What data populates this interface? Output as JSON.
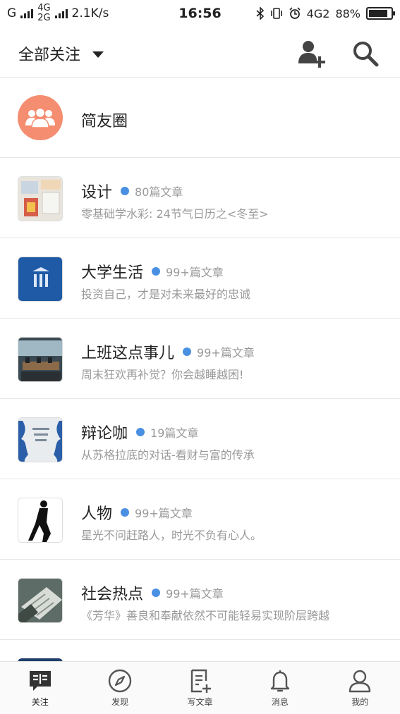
{
  "status_bar": {
    "sim1": "G",
    "net_top": "4G",
    "net_bottom": "2G",
    "speed": "2.1K/s",
    "time": "16:56",
    "net_right": "4G2",
    "battery": "88%",
    "battery_level": 0.88
  },
  "header": {
    "title": "全部关注"
  },
  "circle": {
    "label": "简友圈",
    "color": "#f58d70"
  },
  "feeds": [
    {
      "name": "设计",
      "count": "80篇文章",
      "subtitle": "零基础学水彩: 24节气日历之<冬至>",
      "thumb": "design"
    },
    {
      "name": "大学生活",
      "count": "99+篇文章",
      "subtitle": "投资自己，才是对未来最好的忠诚",
      "thumb": "college"
    },
    {
      "name": "上班这点事儿",
      "count": "99+篇文章",
      "subtitle": "周末狂欢再补觉？你会越睡越困!",
      "thumb": "office"
    },
    {
      "name": "辩论咖",
      "count": "19篇文章",
      "subtitle": "从苏格拉底的对话-看财与富的传承",
      "thumb": "debate"
    },
    {
      "name": "人物",
      "count": "99+篇文章",
      "subtitle": "星光不问赶路人，时光不负有心人。",
      "thumb": "people"
    },
    {
      "name": "社会热点",
      "count": "99+篇文章",
      "subtitle": "《芳华》善良和奉献依然不可能轻易实现阶层跨越",
      "thumb": "news"
    }
  ],
  "nav": {
    "items": [
      {
        "label": "关注",
        "icon": "follow-icon"
      },
      {
        "label": "发现",
        "icon": "compass-icon"
      },
      {
        "label": "写文章",
        "icon": "write-icon"
      },
      {
        "label": "消息",
        "icon": "bell-icon"
      },
      {
        "label": "我的",
        "icon": "user-icon"
      }
    ]
  },
  "colors": {
    "accent_dot": "#4a90e2",
    "divider": "#e6e6e6"
  }
}
